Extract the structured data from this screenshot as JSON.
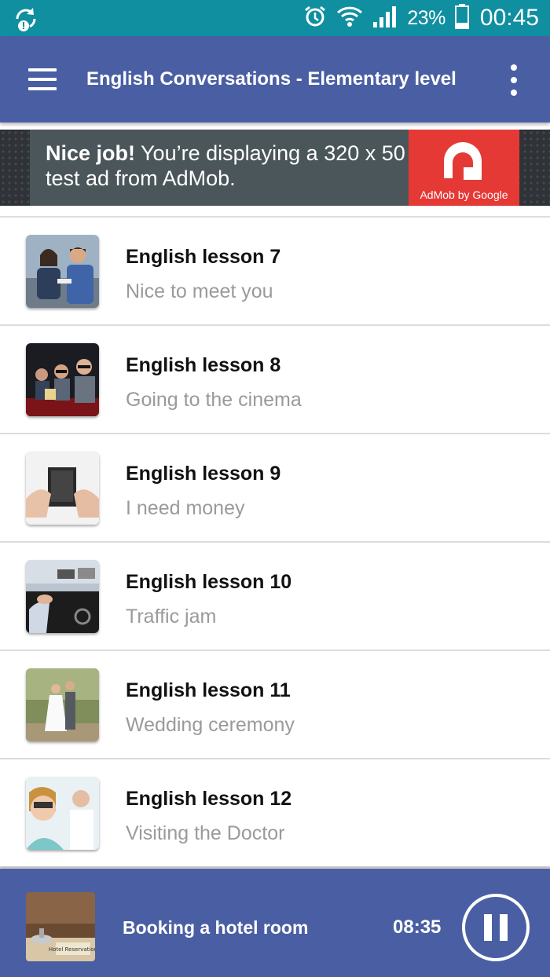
{
  "status_bar": {
    "battery_percent": "23%",
    "time": "00:45",
    "icons": [
      "sync-alert-icon",
      "alarm-clock-icon",
      "wifi-icon",
      "signal-icon",
      "battery-icon"
    ]
  },
  "app_bar": {
    "title": "English Conversations - Elementary level",
    "menu_icon": "hamburger-menu-icon",
    "more_icon": "more-vert-icon"
  },
  "ad": {
    "bold_text": "Nice job!",
    "text_line1": " You’re displaying a 320 x 50",
    "text_line2": "test ad from AdMob.",
    "logo_caption": "AdMob by Google"
  },
  "lessons": [
    {
      "title": "English lesson 7",
      "subtitle": "Nice to meet you",
      "thumb_icon": "business-meeting-photo"
    },
    {
      "title": "English lesson 8",
      "subtitle": "Going to the cinema",
      "thumb_icon": "cinema-audience-photo"
    },
    {
      "title": "English lesson 9",
      "subtitle": "I need money",
      "thumb_icon": "empty-wallet-photo"
    },
    {
      "title": "English lesson 10",
      "subtitle": "Traffic jam",
      "thumb_icon": "traffic-jam-photo"
    },
    {
      "title": "English lesson 11",
      "subtitle": "Wedding ceremony",
      "thumb_icon": "wedding-couple-photo"
    },
    {
      "title": "English lesson 12",
      "subtitle": "Visiting the Doctor",
      "thumb_icon": "eye-doctor-photo"
    }
  ],
  "player": {
    "title": "Booking a hotel room",
    "time": "08:35",
    "thumb_caption": "Hotel Reservation",
    "control_icon": "pause-icon"
  },
  "colors": {
    "status_bar": "#0f8fa0",
    "primary": "#4a5fa3",
    "ad_red": "#e53935",
    "divider": "#dcdcdc",
    "subtitle_gray": "#9a9a9a"
  }
}
